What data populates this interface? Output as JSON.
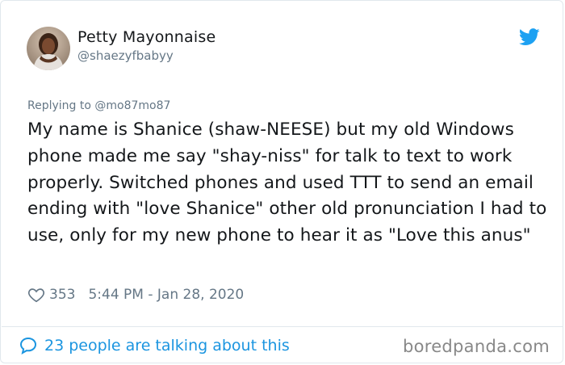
{
  "user": {
    "name": "Petty Mayonnaise",
    "handle": "@shaezyfbabyy"
  },
  "tweet": {
    "replying_to": "Replying to @mo87mo87",
    "text": "My name is Shanice (shaw-NEESE) but my old Windows phone made me say \"shay-niss\" for talk to text to work properly. Switched phones and used TTT to send an email ending with \"love Shanice\" other old pronunciation I had to use, only for my new phone to hear it as \"Love this anus\"",
    "likes": "353",
    "timestamp": "5:44 PM - Jan 28, 2020"
  },
  "footer": {
    "talking": "23 people are talking about this",
    "watermark": "boredpanda.com"
  },
  "colors": {
    "accent": "#1da1f2",
    "link": "#1b95e0",
    "muted": "#657786"
  },
  "icons": {
    "logo": "twitter-bird-icon",
    "like": "heart-outline-icon",
    "talk": "speech-bubble-icon"
  }
}
